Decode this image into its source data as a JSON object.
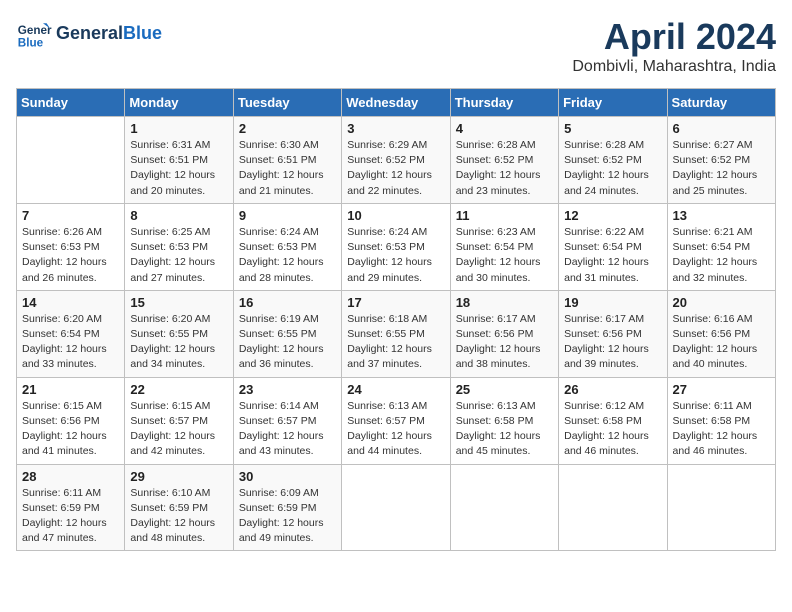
{
  "header": {
    "logo_line1": "General",
    "logo_line2": "Blue",
    "title": "April 2024",
    "location": "Dombivli, Maharashtra, India"
  },
  "weekdays": [
    "Sunday",
    "Monday",
    "Tuesday",
    "Wednesday",
    "Thursday",
    "Friday",
    "Saturday"
  ],
  "weeks": [
    [
      {
        "day": "",
        "info": ""
      },
      {
        "day": "1",
        "info": "Sunrise: 6:31 AM\nSunset: 6:51 PM\nDaylight: 12 hours\nand 20 minutes."
      },
      {
        "day": "2",
        "info": "Sunrise: 6:30 AM\nSunset: 6:51 PM\nDaylight: 12 hours\nand 21 minutes."
      },
      {
        "day": "3",
        "info": "Sunrise: 6:29 AM\nSunset: 6:52 PM\nDaylight: 12 hours\nand 22 minutes."
      },
      {
        "day": "4",
        "info": "Sunrise: 6:28 AM\nSunset: 6:52 PM\nDaylight: 12 hours\nand 23 minutes."
      },
      {
        "day": "5",
        "info": "Sunrise: 6:28 AM\nSunset: 6:52 PM\nDaylight: 12 hours\nand 24 minutes."
      },
      {
        "day": "6",
        "info": "Sunrise: 6:27 AM\nSunset: 6:52 PM\nDaylight: 12 hours\nand 25 minutes."
      }
    ],
    [
      {
        "day": "7",
        "info": "Sunrise: 6:26 AM\nSunset: 6:53 PM\nDaylight: 12 hours\nand 26 minutes."
      },
      {
        "day": "8",
        "info": "Sunrise: 6:25 AM\nSunset: 6:53 PM\nDaylight: 12 hours\nand 27 minutes."
      },
      {
        "day": "9",
        "info": "Sunrise: 6:24 AM\nSunset: 6:53 PM\nDaylight: 12 hours\nand 28 minutes."
      },
      {
        "day": "10",
        "info": "Sunrise: 6:24 AM\nSunset: 6:53 PM\nDaylight: 12 hours\nand 29 minutes."
      },
      {
        "day": "11",
        "info": "Sunrise: 6:23 AM\nSunset: 6:54 PM\nDaylight: 12 hours\nand 30 minutes."
      },
      {
        "day": "12",
        "info": "Sunrise: 6:22 AM\nSunset: 6:54 PM\nDaylight: 12 hours\nand 31 minutes."
      },
      {
        "day": "13",
        "info": "Sunrise: 6:21 AM\nSunset: 6:54 PM\nDaylight: 12 hours\nand 32 minutes."
      }
    ],
    [
      {
        "day": "14",
        "info": "Sunrise: 6:20 AM\nSunset: 6:54 PM\nDaylight: 12 hours\nand 33 minutes."
      },
      {
        "day": "15",
        "info": "Sunrise: 6:20 AM\nSunset: 6:55 PM\nDaylight: 12 hours\nand 34 minutes."
      },
      {
        "day": "16",
        "info": "Sunrise: 6:19 AM\nSunset: 6:55 PM\nDaylight: 12 hours\nand 36 minutes."
      },
      {
        "day": "17",
        "info": "Sunrise: 6:18 AM\nSunset: 6:55 PM\nDaylight: 12 hours\nand 37 minutes."
      },
      {
        "day": "18",
        "info": "Sunrise: 6:17 AM\nSunset: 6:56 PM\nDaylight: 12 hours\nand 38 minutes."
      },
      {
        "day": "19",
        "info": "Sunrise: 6:17 AM\nSunset: 6:56 PM\nDaylight: 12 hours\nand 39 minutes."
      },
      {
        "day": "20",
        "info": "Sunrise: 6:16 AM\nSunset: 6:56 PM\nDaylight: 12 hours\nand 40 minutes."
      }
    ],
    [
      {
        "day": "21",
        "info": "Sunrise: 6:15 AM\nSunset: 6:56 PM\nDaylight: 12 hours\nand 41 minutes."
      },
      {
        "day": "22",
        "info": "Sunrise: 6:15 AM\nSunset: 6:57 PM\nDaylight: 12 hours\nand 42 minutes."
      },
      {
        "day": "23",
        "info": "Sunrise: 6:14 AM\nSunset: 6:57 PM\nDaylight: 12 hours\nand 43 minutes."
      },
      {
        "day": "24",
        "info": "Sunrise: 6:13 AM\nSunset: 6:57 PM\nDaylight: 12 hours\nand 44 minutes."
      },
      {
        "day": "25",
        "info": "Sunrise: 6:13 AM\nSunset: 6:58 PM\nDaylight: 12 hours\nand 45 minutes."
      },
      {
        "day": "26",
        "info": "Sunrise: 6:12 AM\nSunset: 6:58 PM\nDaylight: 12 hours\nand 46 minutes."
      },
      {
        "day": "27",
        "info": "Sunrise: 6:11 AM\nSunset: 6:58 PM\nDaylight: 12 hours\nand 46 minutes."
      }
    ],
    [
      {
        "day": "28",
        "info": "Sunrise: 6:11 AM\nSunset: 6:59 PM\nDaylight: 12 hours\nand 47 minutes."
      },
      {
        "day": "29",
        "info": "Sunrise: 6:10 AM\nSunset: 6:59 PM\nDaylight: 12 hours\nand 48 minutes."
      },
      {
        "day": "30",
        "info": "Sunrise: 6:09 AM\nSunset: 6:59 PM\nDaylight: 12 hours\nand 49 minutes."
      },
      {
        "day": "",
        "info": ""
      },
      {
        "day": "",
        "info": ""
      },
      {
        "day": "",
        "info": ""
      },
      {
        "day": "",
        "info": ""
      }
    ]
  ]
}
